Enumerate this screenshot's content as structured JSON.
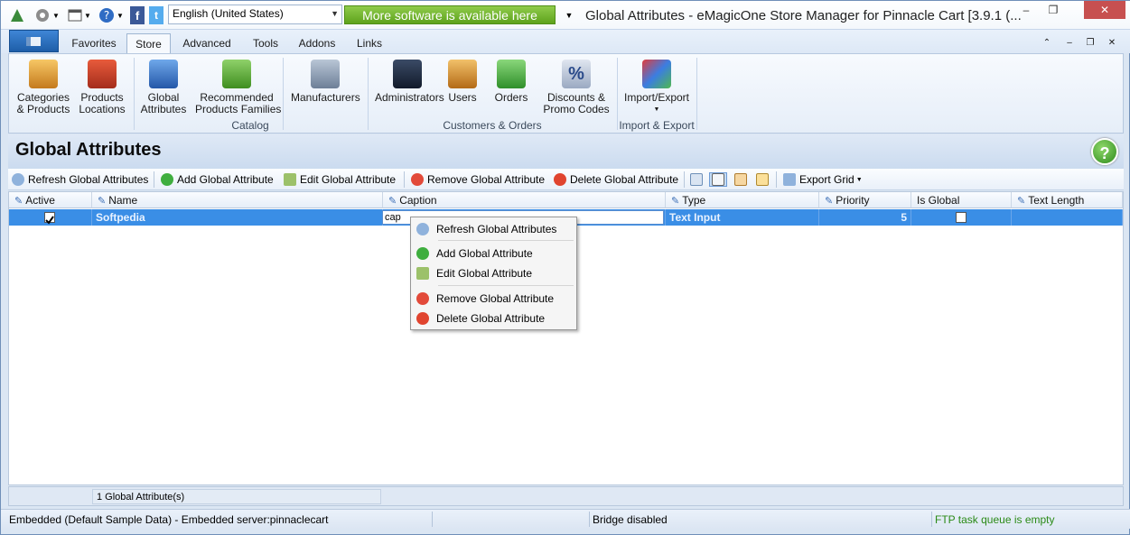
{
  "window": {
    "title": "Global Attributes - eMagicOne Store Manager for Pinnacle Cart [3.9.1 (...",
    "language": "English (United States)",
    "promo": "More software is available here",
    "buttons": {
      "minimize": "–",
      "restore": "❐",
      "close": "✕"
    }
  },
  "tabs": [
    {
      "label": "Favorites"
    },
    {
      "label": "Store"
    },
    {
      "label": "Advanced"
    },
    {
      "label": "Tools"
    },
    {
      "label": "Addons"
    },
    {
      "label": "Links"
    }
  ],
  "ribbon": {
    "buttons": [
      {
        "label": "Categories\n& Products",
        "icon": "box-icon"
      },
      {
        "label": "Products\nLocations",
        "icon": "house-icon"
      },
      {
        "label": "Global\nAttributes",
        "icon": "checklist-icon"
      },
      {
        "label": "Recommended\nProducts Families",
        "icon": "puzzle-icon"
      },
      {
        "label": "Manufacturers",
        "icon": "building-icon"
      },
      {
        "label": "Administrators",
        "icon": "admin-icon"
      },
      {
        "label": "Users",
        "icon": "users-icon"
      },
      {
        "label": "Orders",
        "icon": "orders-icon"
      },
      {
        "label": "Discounts &\nPromo Codes",
        "icon": "percent-icon"
      },
      {
        "label": "Import/Export",
        "icon": "import-export-icon"
      }
    ],
    "groups": [
      "Catalog",
      "Customers & Orders",
      "Import & Export"
    ]
  },
  "page": {
    "title": "Global Attributes"
  },
  "toolbar": {
    "refresh": "Refresh Global Attributes",
    "add": "Add Global Attribute",
    "edit": "Edit Global Attribute",
    "remove": "Remove Global Attribute",
    "delete": "Delete Global Attribute",
    "export": "Export Grid"
  },
  "grid": {
    "columns": [
      "Active",
      "Name",
      "Caption",
      "Type",
      "Priority",
      "Is Global",
      "Text Length"
    ],
    "rows": [
      {
        "active": true,
        "name": "Softpedia",
        "caption": "cap",
        "type": "Text Input",
        "priority": "5",
        "is_global": false,
        "text_length": ""
      }
    ],
    "footer": "1 Global Attribute(s)"
  },
  "context_menu": {
    "items": [
      {
        "label": "Refresh Global Attributes"
      },
      {
        "label": "Add Global Attribute"
      },
      {
        "label": "Edit Global Attribute"
      },
      {
        "label": "Remove Global Attribute"
      },
      {
        "label": "Delete Global Attribute"
      }
    ]
  },
  "status": {
    "connection": "Embedded (Default Sample Data) - Embedded server:pinnaclecart",
    "bridge": "Bridge disabled",
    "ftp": "FTP task queue is empty"
  },
  "colors": {
    "accent": "#3a8ee6",
    "promo": "#6fb12a",
    "ftp": "#2a8a16"
  }
}
